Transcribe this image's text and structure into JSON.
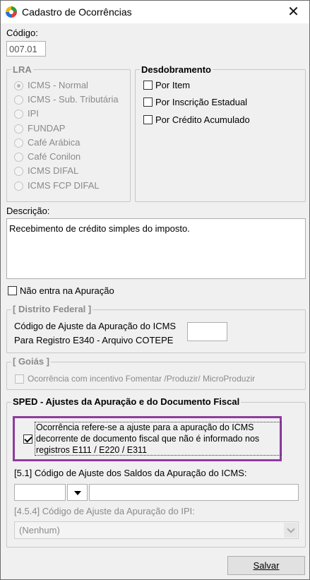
{
  "window": {
    "title": "Cadastro de Ocorrências",
    "close_glyph": "✕"
  },
  "codigo": {
    "label": "Código:",
    "value": "007.01"
  },
  "lra": {
    "legend": "LRA",
    "options": [
      "ICMS - Normal",
      "ICMS - Sub. Tributária",
      "IPI",
      "FUNDAP",
      "Café Arábica",
      "Café Conilon",
      "ICMS DIFAL",
      "ICMS FCP DIFAL"
    ],
    "selected_index": 0
  },
  "desdobramento": {
    "legend": "Desdobramento",
    "options": [
      "Por Item",
      "Por Inscrição Estadual",
      "Por Crédito Acumulado"
    ]
  },
  "descricao": {
    "label": "Descrição:",
    "value": "Recebimento de crédito simples do imposto."
  },
  "nao_entra": {
    "label": "Não entra na Apuração",
    "checked": false
  },
  "distrito_federal": {
    "legend": "[ Distrito Federal ]",
    "line1": "Código de Ajuste da Apuração do ICMS",
    "line2": "Para Registro E340 - Arquivo COTEPE",
    "value": ""
  },
  "goias": {
    "legend": "[ Goiás ]",
    "checkbox_label": "Ocorrência com incentivo Fomentar /Produzir/ MicroProduzir"
  },
  "sped": {
    "legend": "SPED - Ajustes da Apuração e do Documento Fiscal",
    "ajuste_check": {
      "line1": "Ocorrência refere-se a ajuste para a apuração do ICMS",
      "line2": "decorrente de documento fiscal que não é informado nos",
      "line3": "registros E111 / E220 / E311",
      "checked": true
    },
    "codigo_saldos_label": "[5.1] Código de Ajuste dos Saldos da Apuração do ICMS:",
    "codigo_saldos_value": "",
    "codigo_saldos_desc": "",
    "codigo_ipi_label": "[4.5.4] Código de Ajuste da Apuração do IPI:",
    "codigo_ipi_selected": "(Nenhum)"
  },
  "buttons": {
    "salvar": "Salvar"
  }
}
